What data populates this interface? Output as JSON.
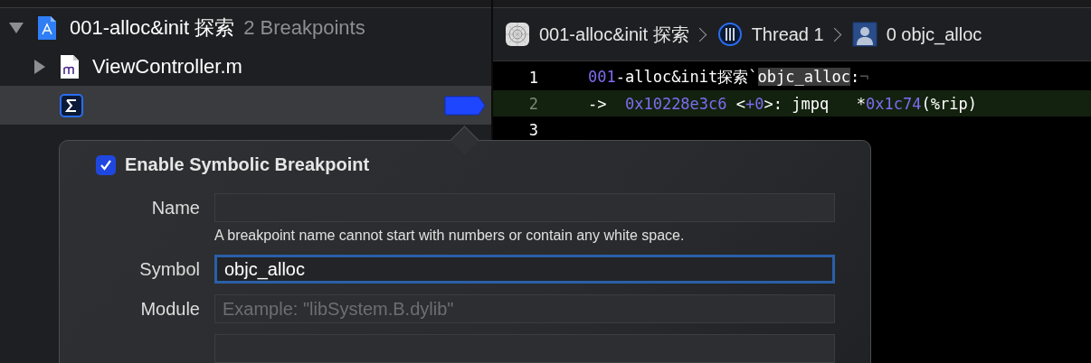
{
  "navigator": {
    "project": {
      "name": "001-alloc&init 探索",
      "count": "2 Breakpoints",
      "expanded": true
    },
    "file": {
      "name": "ViewController.m",
      "expanded": false
    },
    "breakpoint_row": {
      "selected": true,
      "enabled": true
    }
  },
  "breadcrumb": [
    {
      "kind": "app",
      "label": "001-alloc&init 探索"
    },
    {
      "kind": "thread",
      "label": "Thread 1"
    },
    {
      "kind": "frame",
      "label": "0 objc_alloc"
    }
  ],
  "code_lines": [
    {
      "number": "1",
      "current": false,
      "segments": [
        {
          "kind": "number",
          "text": "001"
        },
        {
          "kind": "plain",
          "text": "-alloc&init探索`"
        },
        {
          "kind": "selected",
          "text": "objc_alloc"
        },
        {
          "kind": "plain",
          "text": ":"
        },
        {
          "kind": "invisible",
          "text": "¬"
        }
      ]
    },
    {
      "number": "2",
      "current": true,
      "segments": [
        {
          "kind": "plain",
          "text": "->  "
        },
        {
          "kind": "number",
          "text": "0x10228e3c6"
        },
        {
          "kind": "plain",
          "text": " <"
        },
        {
          "kind": "number",
          "text": "+0"
        },
        {
          "kind": "plain",
          "text": ">: jmpq   *"
        },
        {
          "kind": "number",
          "text": "0x1c74"
        },
        {
          "kind": "plain",
          "text": "(%rip)"
        }
      ]
    },
    {
      "number": "3",
      "current": false
    }
  ],
  "popover": {
    "enable": {
      "label": "Enable Symbolic Breakpoint",
      "checked": true
    },
    "fields": [
      {
        "label": "Name",
        "focused": false,
        "hint": "A breakpoint name cannot start with numbers or contain any white space."
      },
      {
        "label": "Symbol",
        "value": "objc_alloc",
        "focused": true
      },
      {
        "label": "Module",
        "placeholder": "Example: \"libSystem.B.dylib\"",
        "focused": false
      }
    ]
  }
}
